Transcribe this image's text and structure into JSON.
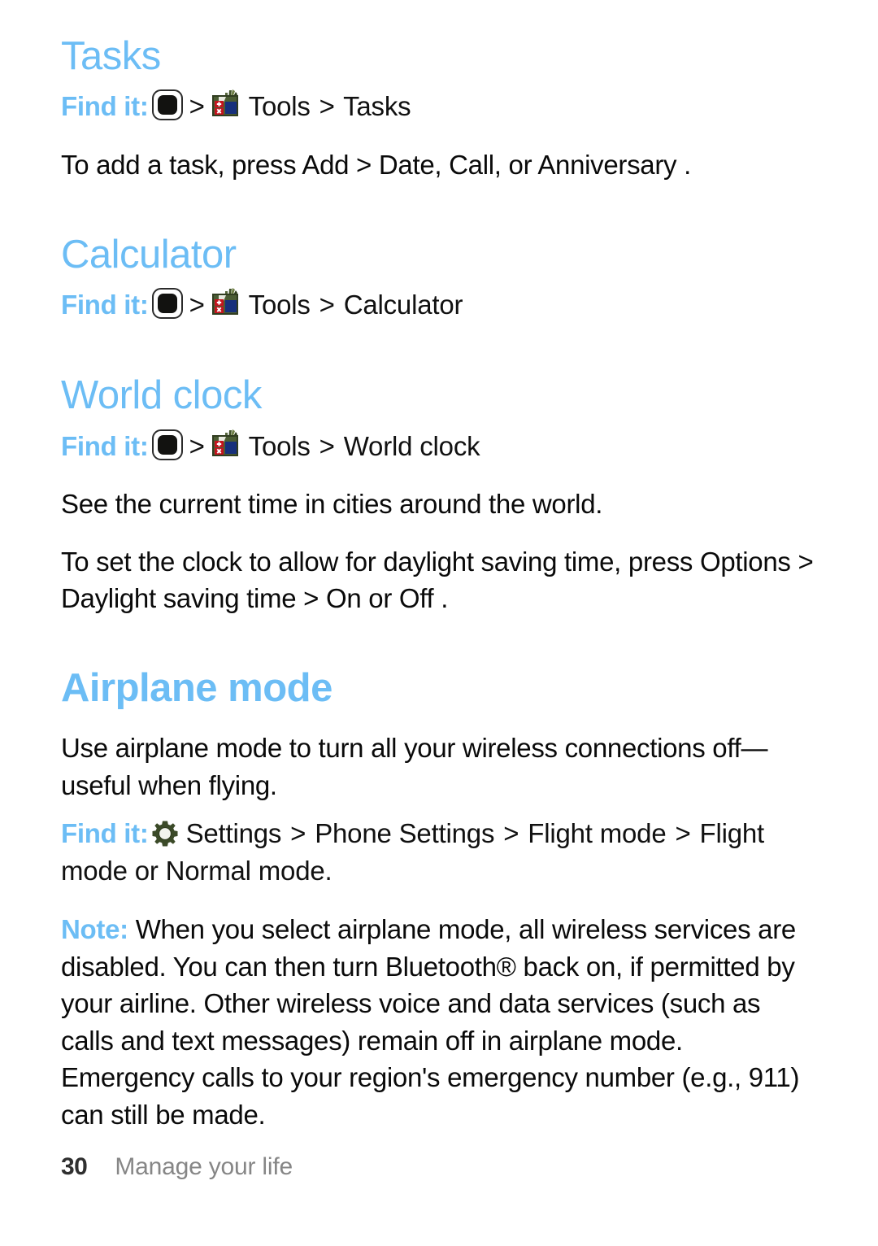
{
  "page": {
    "number": "30",
    "chapter": "Manage your life",
    "accent_color": "#6cbdf5",
    "text_color": "#000000",
    "background_color": "#ffffff"
  },
  "icons": {
    "menu_key": "menu-key-icon",
    "tools": "tools-icon",
    "gear": "gear-icon",
    "chevron": ">"
  },
  "sections": [
    {
      "id": "tasks",
      "title": "Tasks",
      "findit": {
        "lead": "Find it:",
        "sep1": ">",
        "app": "Tools",
        "sep2": ">",
        "target": "Tasks"
      },
      "body": [
        "To add a task, press Add > Date, Call, or Anniversary ."
      ]
    },
    {
      "id": "calculator",
      "title": "Calculator",
      "findit": {
        "lead": "Find it:",
        "sep1": ">",
        "app": "Tools",
        "sep2": ">",
        "target": "Calculator"
      },
      "body": []
    },
    {
      "id": "world-clock",
      "title": "World clock",
      "findit": {
        "lead": "Find it:",
        "sep1": ">",
        "app": "Tools",
        "sep2": ">",
        "target": "World clock"
      },
      "body": [
        "See the current time in cities around the world.",
        "To set the clock to allow for daylight saving time, press Options > Daylight saving time > On or Off ."
      ]
    },
    {
      "id": "airplane-mode",
      "title": "Airplane mode",
      "body_before": "Use airplane mode to turn all your wireless connections off—useful when flying.",
      "findit": {
        "lead": "Find it:",
        "app": "Settings",
        "sep1": ">",
        "step1": "Phone Settings",
        "sep2": ">",
        "step2": "Flight mode",
        "sep3": ">",
        "step3": "Flight mode",
        "conj": "or",
        "step4": "Normal mode",
        "period": "."
      },
      "note": {
        "lead": "Note:",
        "text": "When you select airplane mode, all wireless services are disabled. You can then turn Bluetooth® back on, if permitted by your airline. Other wireless voice and data services (such as calls and text messages) remain off in airplane mode. Emergency calls to your region's emergency number (e.g., 911) can still be made."
      }
    }
  ]
}
